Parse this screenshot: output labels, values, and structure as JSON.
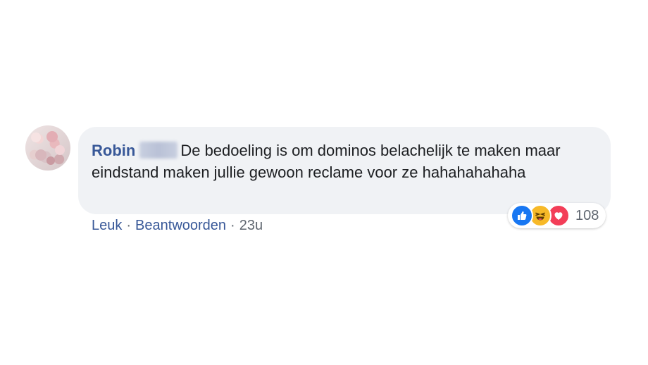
{
  "comment": {
    "author": "Robin",
    "text": "De bedoeling is om dominos belachelijk te maken maar eindstand maken jullie gewoon reclame voor ze hahahahahaha"
  },
  "reactions": {
    "icons": [
      "like-icon",
      "haha-icon",
      "love-icon"
    ],
    "count": "108",
    "colors": {
      "like": "#1877f2",
      "haha": "#f7b928",
      "love": "#f33e58"
    }
  },
  "actions": {
    "like_label": "Leuk",
    "separator": "·",
    "reply_label": "Beantwoorden",
    "timestamp": "23u"
  }
}
